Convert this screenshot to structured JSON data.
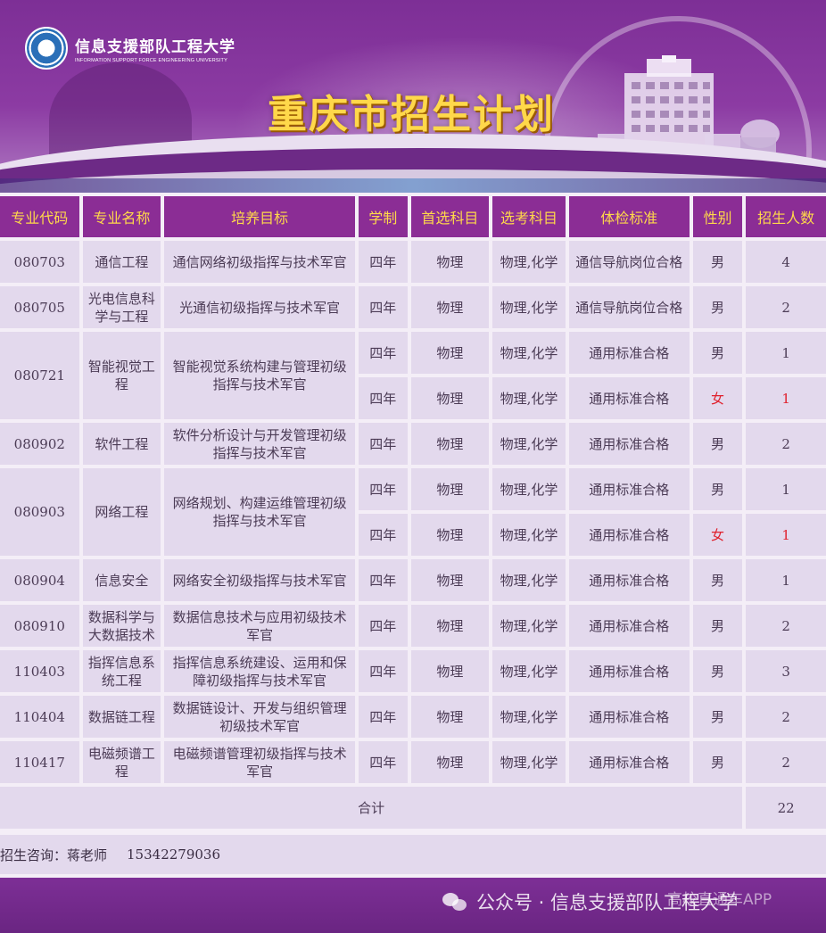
{
  "header": {
    "university_cn": "信息支援部队工程大学",
    "university_en": "INFORMATION SUPPORT FORCE ENGINEERING UNIVERSITY",
    "title": "重庆市招生计划"
  },
  "table": {
    "headers": [
      "专业代码",
      "专业名称",
      "培养目标",
      "学制",
      "首选科目",
      "选考科目",
      "体检标准",
      "性别",
      "招生人数"
    ],
    "rows": [
      {
        "code": "080703",
        "name": "通信工程",
        "goal": "通信网络初级指挥与技术军官",
        "years": "四年",
        "first": "物理",
        "elective": "物理,化学",
        "medical": "通信导航岗位合格",
        "gender": "男",
        "count": "4"
      },
      {
        "code": "080705",
        "name": "光电信息科学与工程",
        "goal": "光通信初级指挥与技术军官",
        "years": "四年",
        "first": "物理",
        "elective": "物理,化学",
        "medical": "通信导航岗位合格",
        "gender": "男",
        "count": "2"
      },
      {
        "code": "080721",
        "name": "智能视觉工程",
        "goal": "智能视觉系统构建与管理初级指挥与技术军官",
        "years": "四年",
        "first": "物理",
        "elective": "物理,化学",
        "medical": "通用标准合格",
        "gender": "男",
        "count": "1"
      },
      {
        "years": "四年",
        "first": "物理",
        "elective": "物理,化学",
        "medical": "通用标准合格",
        "gender": "女",
        "count": "1"
      },
      {
        "code": "080902",
        "name": "软件工程",
        "goal": "软件分析设计与开发管理初级指挥与技术军官",
        "years": "四年",
        "first": "物理",
        "elective": "物理,化学",
        "medical": "通用标准合格",
        "gender": "男",
        "count": "2"
      },
      {
        "code": "080903",
        "name": "网络工程",
        "goal": "网络规划、构建运维管理初级指挥与技术军官",
        "years": "四年",
        "first": "物理",
        "elective": "物理,化学",
        "medical": "通用标准合格",
        "gender": "男",
        "count": "1"
      },
      {
        "years": "四年",
        "first": "物理",
        "elective": "物理,化学",
        "medical": "通用标准合格",
        "gender": "女",
        "count": "1"
      },
      {
        "code": "080904",
        "name": "信息安全",
        "goal": "网络安全初级指挥与技术军官",
        "years": "四年",
        "first": "物理",
        "elective": "物理,化学",
        "medical": "通用标准合格",
        "gender": "男",
        "count": "1"
      },
      {
        "code": "080910",
        "name": "数据科学与大数据技术",
        "goal": "数据信息技术与应用初级技术军官",
        "years": "四年",
        "first": "物理",
        "elective": "物理,化学",
        "medical": "通用标准合格",
        "gender": "男",
        "count": "2"
      },
      {
        "code": "110403",
        "name": "指挥信息系统工程",
        "goal": "指挥信息系统建设、运用和保障初级指挥与技术军官",
        "years": "四年",
        "first": "物理",
        "elective": "物理,化学",
        "medical": "通用标准合格",
        "gender": "男",
        "count": "3"
      },
      {
        "code": "110404",
        "name": "数据链工程",
        "goal": "数据链设计、开发与组织管理初级技术军官",
        "years": "四年",
        "first": "物理",
        "elective": "物理,化学",
        "medical": "通用标准合格",
        "gender": "男",
        "count": "2"
      },
      {
        "code": "110417",
        "name": "电磁频谱工程",
        "goal": "电磁频谱管理初级指挥与技术军官",
        "years": "四年",
        "first": "物理",
        "elective": "物理,化学",
        "medical": "通用标准合格",
        "gender": "男",
        "count": "2"
      }
    ],
    "total_label": "合计",
    "total_value": "22"
  },
  "contact": {
    "label": "招生咨询：蒋老师",
    "phone": "15342279036"
  },
  "watermark": {
    "text": "公众号 · 信息支援部队工程大学",
    "overlay": "高校直通车APP"
  },
  "colors": {
    "header_bg": "#8b2d95",
    "header_text": "#ffd84a",
    "cell_bg": "#e3d9ed",
    "female_red": "#e0202c"
  }
}
